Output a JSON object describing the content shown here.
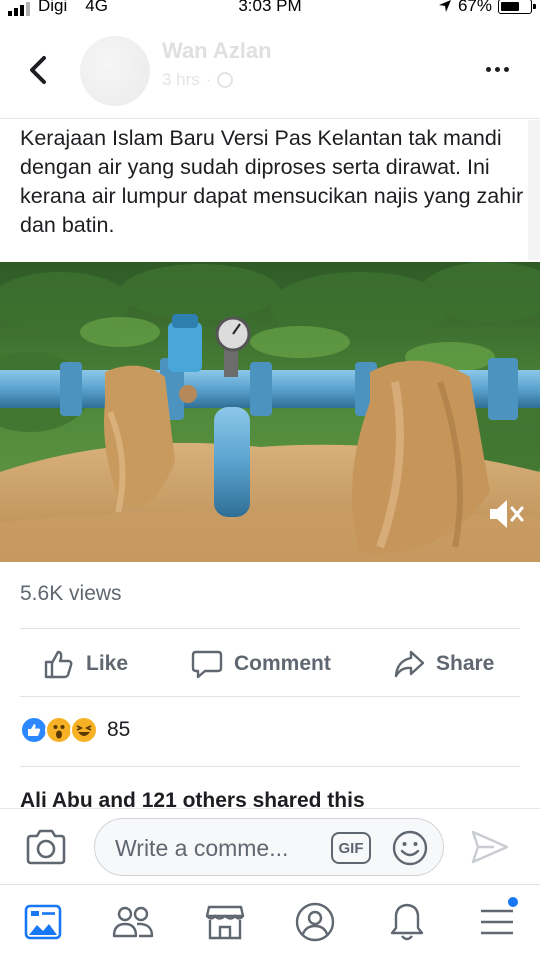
{
  "status_bar": {
    "carrier": "Digi",
    "network": "4G",
    "time": "3:03 PM",
    "battery": "67%",
    "battery_level": 0.67
  },
  "post": {
    "author": "Wan Azlan",
    "time": "3 hrs",
    "caption": "Kerajaan Islam Baru Versi Pas Kelantan tak mandi dengan air yang sudah diproses serta dirawat. Ini kerana air lumpur dapat mensucikan najis yang zahir dan batin.",
    "views": "5.6K views"
  },
  "actions": {
    "like": "Like",
    "comment": "Comment",
    "share": "Share"
  },
  "reactions": {
    "icons": [
      "like-icon",
      "wow-icon",
      "haha-icon"
    ],
    "count": "85"
  },
  "shared_text": "Ali Abu and 121 others shared this",
  "comment_bar": {
    "placeholder": "Write a comme...",
    "gif_label": "GIF"
  },
  "bottom_nav": {
    "items": [
      "news-feed-icon",
      "friends-icon",
      "marketplace-icon",
      "profile-icon",
      "notifications-icon",
      "menu-icon"
    ]
  },
  "colors": {
    "accent": "#1877f2",
    "secondary_text": "#606770",
    "pipe": "#5fa8d3",
    "mud": "#c8a068"
  }
}
